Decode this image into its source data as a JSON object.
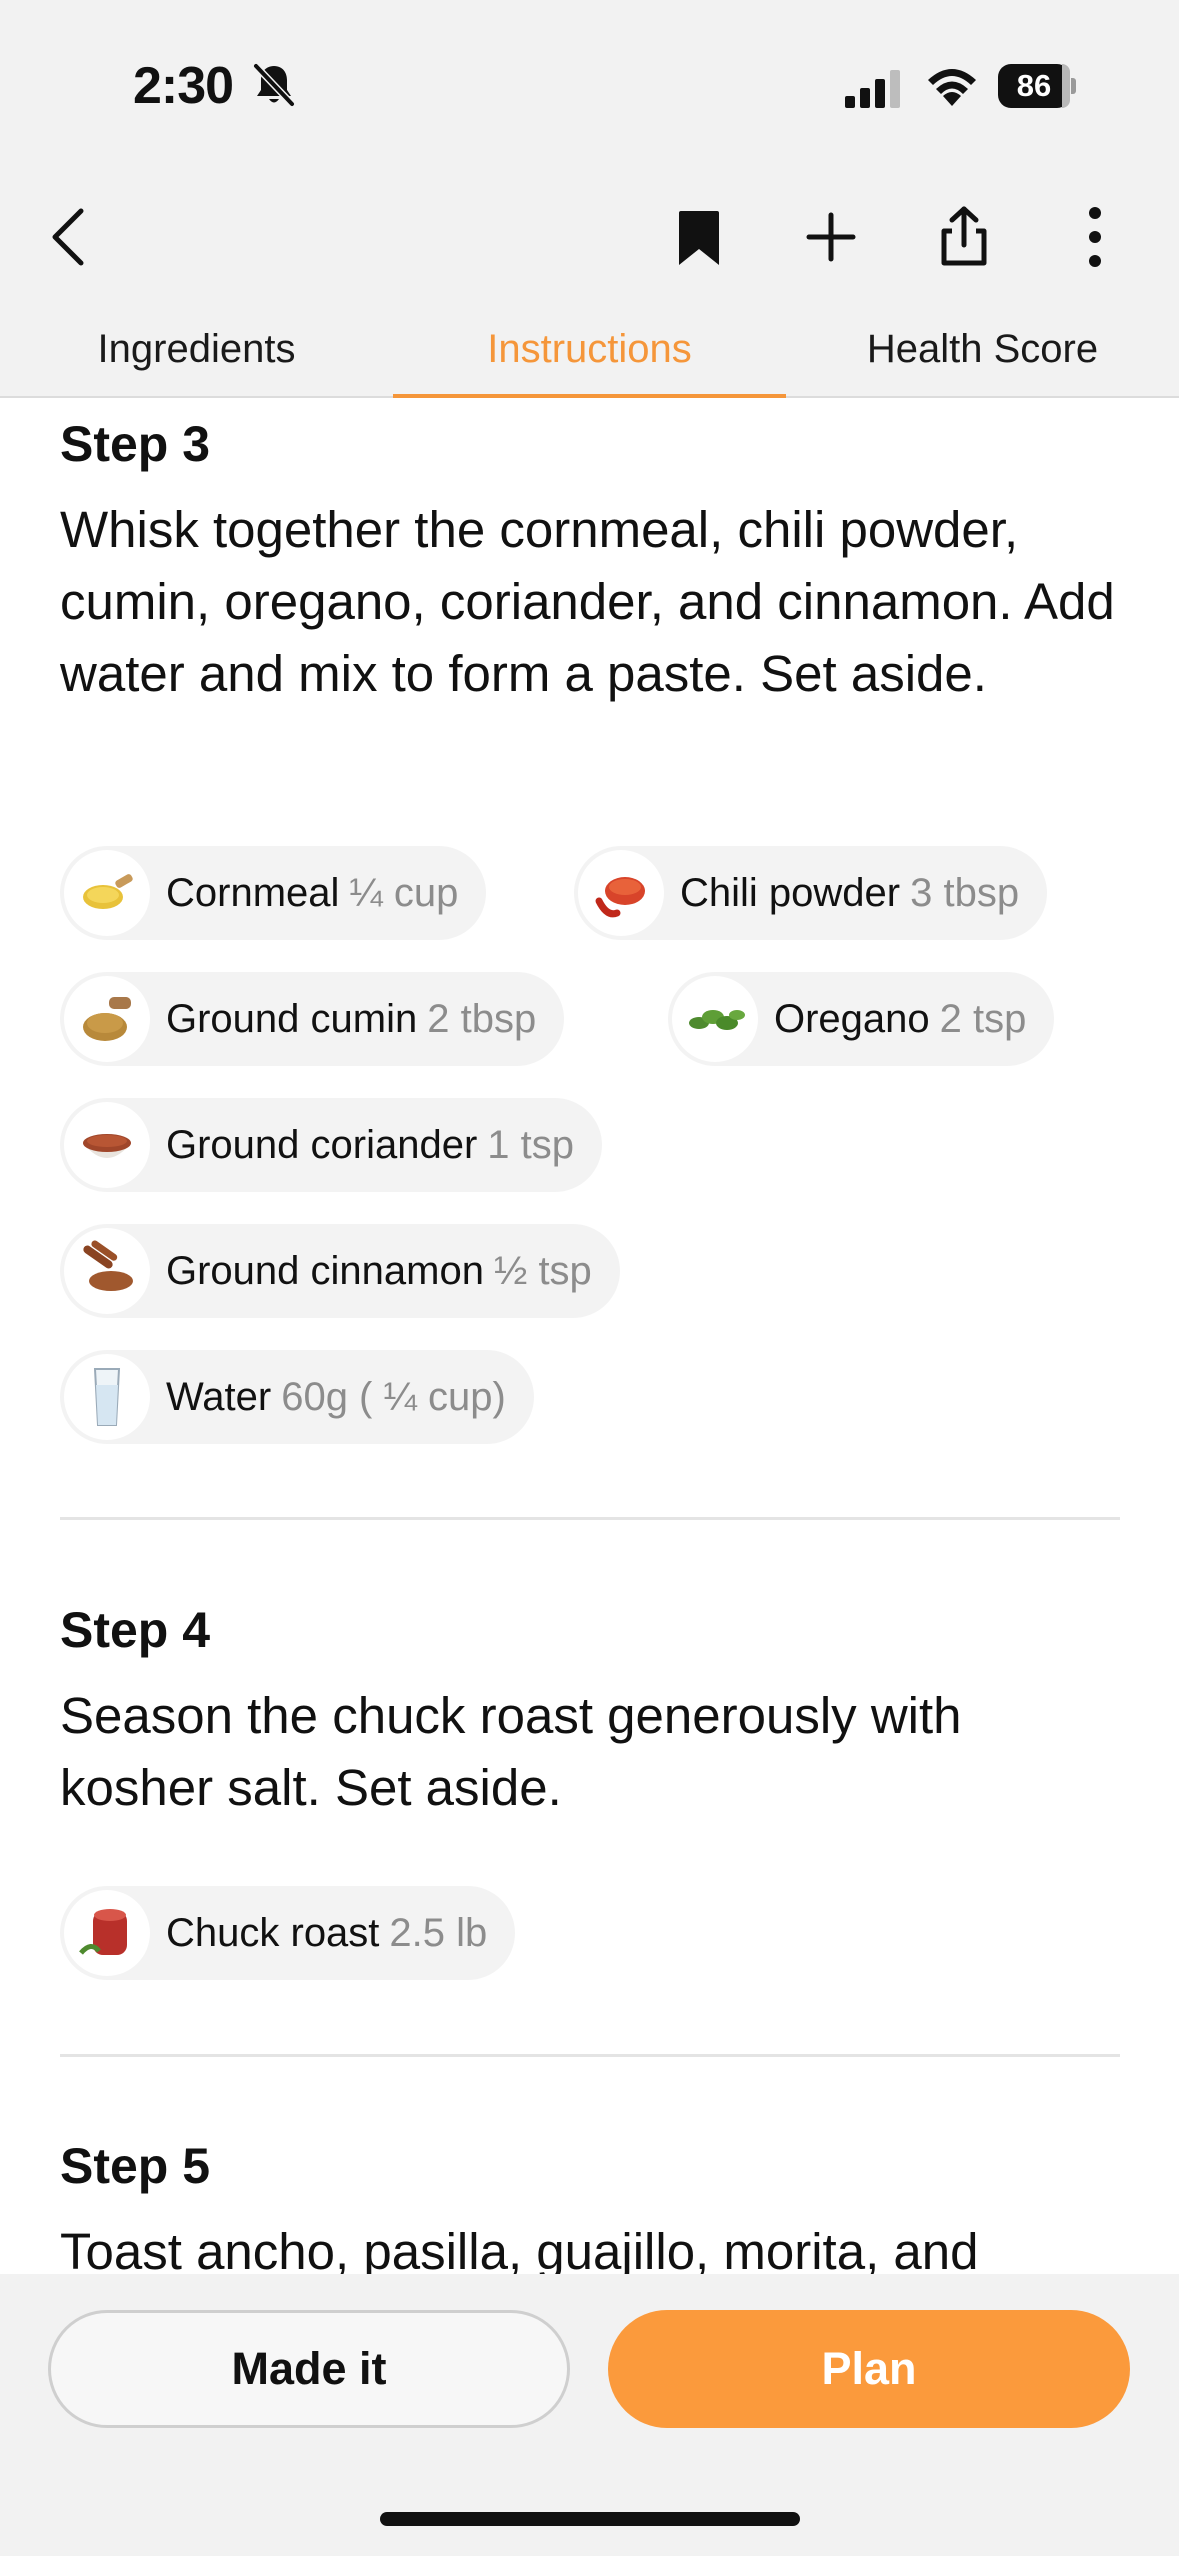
{
  "status_bar": {
    "time": "2:30",
    "battery": "86"
  },
  "nav": {
    "icons": [
      "back-chevron-icon",
      "bookmark-icon",
      "plus-icon",
      "share-icon",
      "more-vertical-icon"
    ]
  },
  "tabs": [
    {
      "label": "Ingredients",
      "active": false
    },
    {
      "label": "Instructions",
      "active": true
    },
    {
      "label": "Health Score",
      "active": false
    }
  ],
  "accent_color": "#f5963a",
  "steps": [
    {
      "title": "Step 3",
      "text": "Whisk together the cornmeal, chili powder, cumin, oregano, coriander, and cinnamon. Add water and mix to form a paste. Set aside.",
      "ingredients": [
        {
          "name": "Cornmeal",
          "amount": "¼ cup",
          "icon": "cornmeal-scoop-icon"
        },
        {
          "name": "Chili powder",
          "amount": "3  tbsp",
          "icon": "chili-powder-icon"
        },
        {
          "name": "Ground cumin",
          "amount": "2  tbsp",
          "icon": "cumin-icon"
        },
        {
          "name": "Oregano",
          "amount": "2  tsp",
          "icon": "oregano-icon"
        },
        {
          "name": "Ground coriander",
          "amount": "1  tsp",
          "icon": "coriander-icon"
        },
        {
          "name": "Ground cinnamon",
          "amount": "½ tsp",
          "icon": "cinnamon-icon"
        },
        {
          "name": "Water",
          "amount": "60g ( ¼ cup)",
          "icon": "water-glass-icon"
        }
      ]
    },
    {
      "title": "Step 4",
      "text": "Season the chuck roast generously with kosher salt. Set aside.",
      "ingredients": [
        {
          "name": "Chuck roast",
          "amount": "2.5 lb",
          "icon": "chuck-roast-icon"
        }
      ]
    },
    {
      "title": "Step 5",
      "text": "Toast ancho, pasilla, guajillo, morita, and"
    }
  ],
  "actions": {
    "made_it": "Made it",
    "plan": "Plan"
  }
}
